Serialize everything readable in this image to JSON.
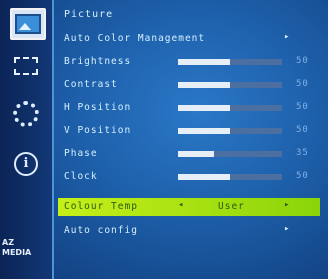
{
  "colors": {
    "background": "#1d5ea8",
    "sidebar": "#123876",
    "highlight": "#b8e816",
    "text": "#d6f0ff"
  },
  "sidebar": {
    "icons": [
      "picture-icon",
      "screen-adjust-icon",
      "gear-icon",
      "info-icon"
    ],
    "info_glyph": "i",
    "logo_line1": "AZ",
    "logo_line2": "MEDIA"
  },
  "menu": {
    "title": "Picture",
    "items": [
      {
        "label": "Auto Color Management",
        "arrow": "▸"
      },
      {
        "label": "Brightness",
        "value": "50",
        "level": 0.5
      },
      {
        "label": "Contrast",
        "value": "50",
        "level": 0.5
      },
      {
        "label": "H Position",
        "value": "50",
        "level": 0.5
      },
      {
        "label": "V Position",
        "value": "50",
        "level": 0.5
      },
      {
        "label": "Phase",
        "value": "35",
        "level": 0.35
      },
      {
        "label": "Clock",
        "value": "50",
        "level": 0.5
      },
      {
        "label": "Colour Temp",
        "left_arrow": "◂",
        "value": "User",
        "right_arrow": "▸"
      },
      {
        "label": "Auto config",
        "arrow": "▸"
      }
    ]
  }
}
